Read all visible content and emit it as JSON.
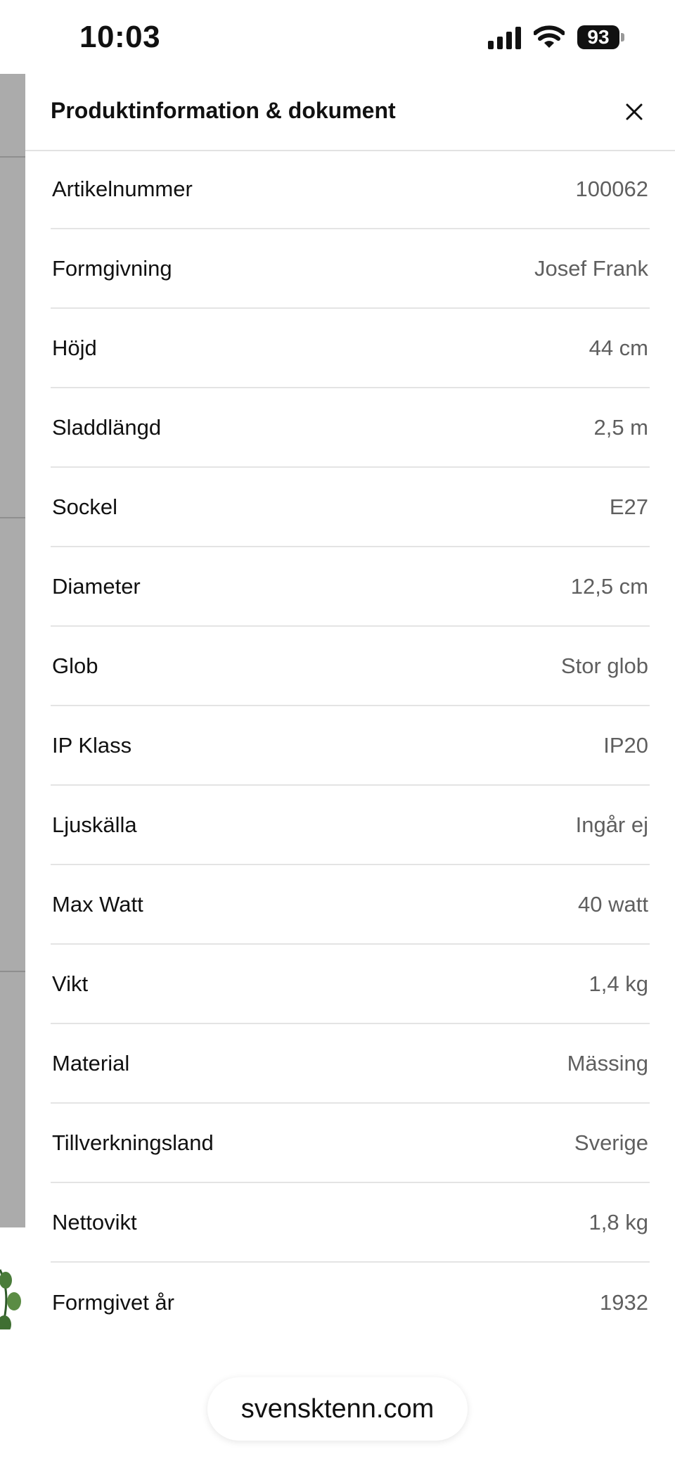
{
  "status_bar": {
    "time": "10:03",
    "battery": "93"
  },
  "drawer": {
    "title": "Produktinformation & dokument",
    "close_icon": "close-icon",
    "specs": [
      {
        "label": "Artikelnummer",
        "value": "100062"
      },
      {
        "label": "Formgivning",
        "value": "Josef Frank"
      },
      {
        "label": "Höjd",
        "value": "44 cm"
      },
      {
        "label": "Sladdlängd",
        "value": "2,5 m"
      },
      {
        "label": "Sockel",
        "value": "E27"
      },
      {
        "label": "Diameter",
        "value": "12,5 cm"
      },
      {
        "label": "Glob",
        "value": "Stor glob"
      },
      {
        "label": "IP Klass",
        "value": "IP20"
      },
      {
        "label": "Ljuskälla",
        "value": "Ingår ej"
      },
      {
        "label": "Max Watt",
        "value": "40 watt"
      },
      {
        "label": "Vikt",
        "value": "1,4 kg"
      },
      {
        "label": "Material",
        "value": "Mässing"
      },
      {
        "label": "Tillverkningsland",
        "value": "Sverige"
      },
      {
        "label": "Nettovikt",
        "value": "1,8 kg"
      },
      {
        "label": "Formgivet år",
        "value": "1932"
      }
    ]
  },
  "browser": {
    "url": "svensktenn.com"
  },
  "colors": {
    "text_primary": "#111111",
    "text_secondary": "#5f5f5f",
    "divider": "#e4e4e4",
    "backdrop": "#ababab"
  }
}
